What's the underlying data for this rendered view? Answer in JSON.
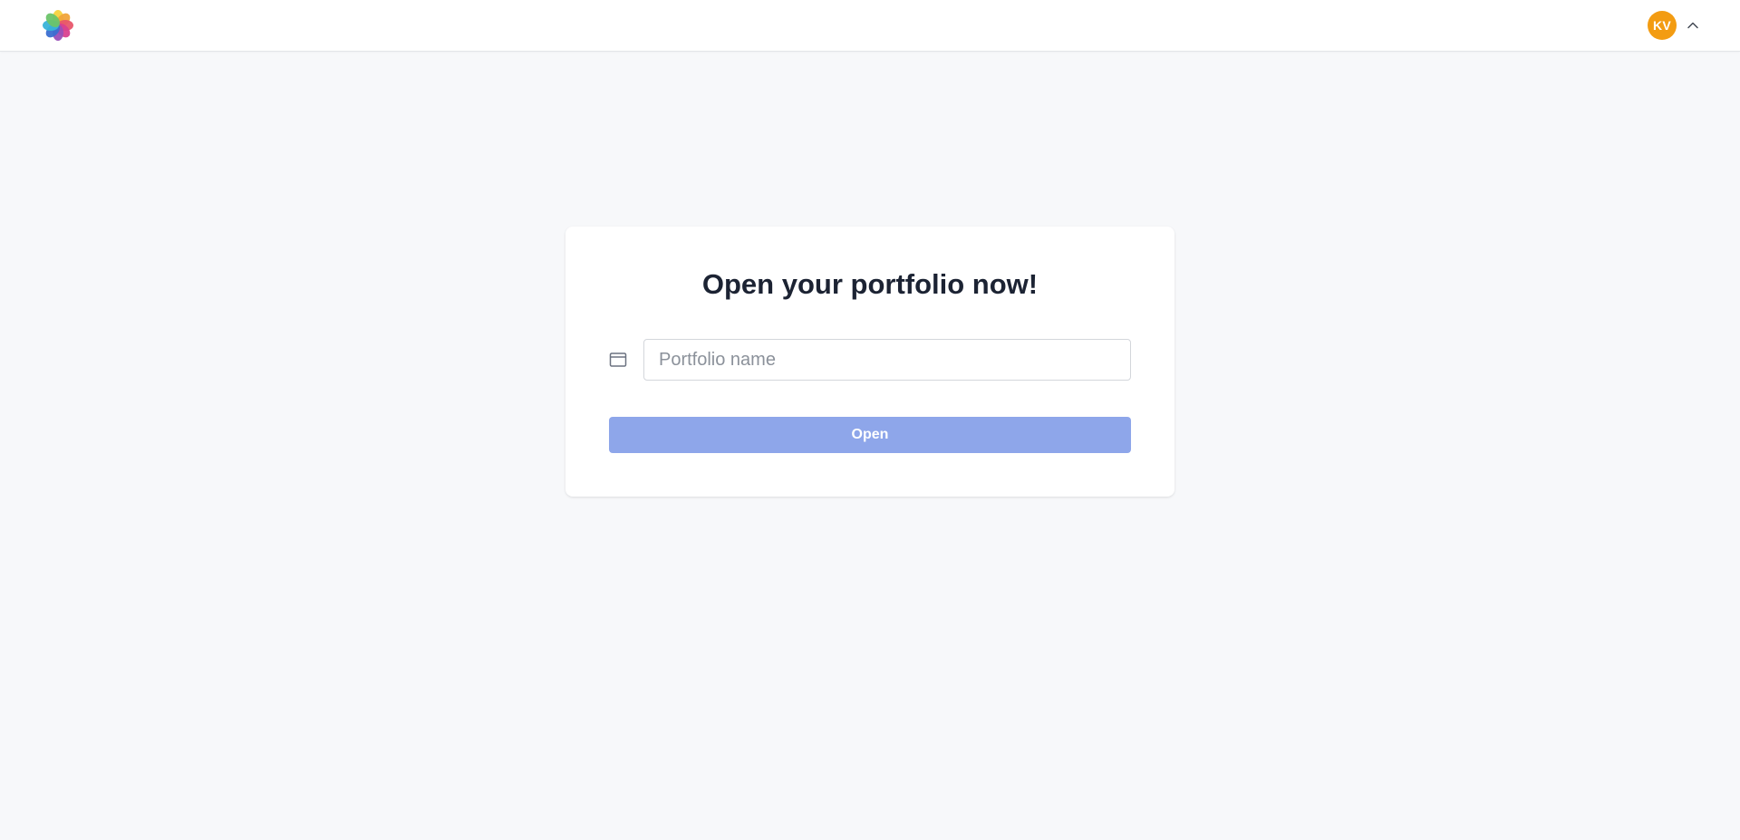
{
  "header": {
    "logo_icon": "flower-logo-icon",
    "user": {
      "initials": "KV",
      "avatar_color": "#f39c12",
      "menu_icon": "chevron-up-icon"
    }
  },
  "card": {
    "title": "Open your portfolio now!",
    "field_icon": "browser-window-icon",
    "portfolio_name": {
      "value": "",
      "placeholder": "Portfolio name"
    },
    "open_button_label": "Open",
    "open_button_color": "#8ea6ea",
    "open_button_disabled": true
  },
  "colors": {
    "background": "#f7f8fa",
    "title_text": "#1c2333"
  }
}
